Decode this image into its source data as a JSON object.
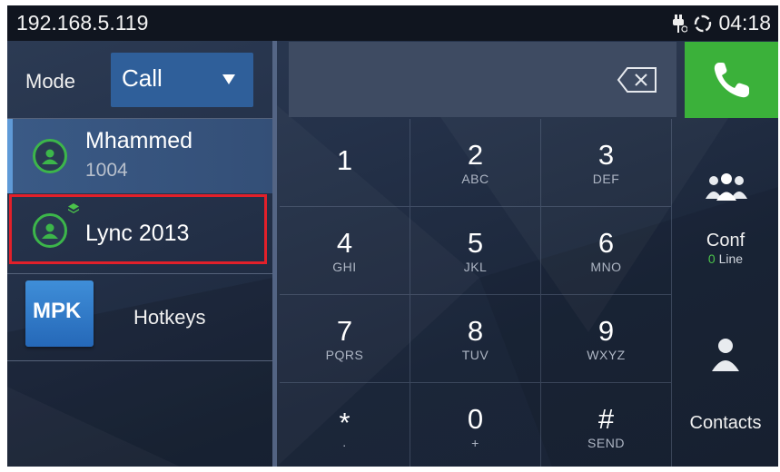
{
  "status": {
    "ip": "192.168.5.119",
    "time": "04:18",
    "icons": [
      "usb-icon",
      "sync-icon"
    ]
  },
  "mode": {
    "label": "Mode",
    "value": "Call"
  },
  "accounts": [
    {
      "name": "Mhammed",
      "ext": "1004",
      "icon": "avatar-icon",
      "selected": true
    },
    {
      "name": "Lync 2013",
      "ext": "",
      "icon": "avatar-icon",
      "badge": "layers-icon"
    }
  ],
  "mpk": {
    "badge": "MPK",
    "label": "Hotkeys"
  },
  "dialpad": {
    "keys": [
      {
        "digit": "1",
        "letters": ""
      },
      {
        "digit": "2",
        "letters": "ABC"
      },
      {
        "digit": "3",
        "letters": "DEF"
      },
      {
        "digit": "4",
        "letters": "GHI"
      },
      {
        "digit": "5",
        "letters": "JKL"
      },
      {
        "digit": "6",
        "letters": "MNO"
      },
      {
        "digit": "7",
        "letters": "PQRS"
      },
      {
        "digit": "8",
        "letters": "TUV"
      },
      {
        "digit": "9",
        "letters": "WXYZ"
      },
      {
        "digit": "*",
        "letters": "·"
      },
      {
        "digit": "0",
        "letters": "+"
      },
      {
        "digit": "#",
        "letters": "SEND"
      }
    ]
  },
  "conf": {
    "label": "Conf",
    "count": "0",
    "unit": " Line"
  },
  "contacts": {
    "label": "Contacts"
  },
  "colors": {
    "call_green": "#3bb13a",
    "accent_blue": "#2f5f9a",
    "highlight_red": "#e2202a",
    "avatar_green": "#3cb64a"
  }
}
